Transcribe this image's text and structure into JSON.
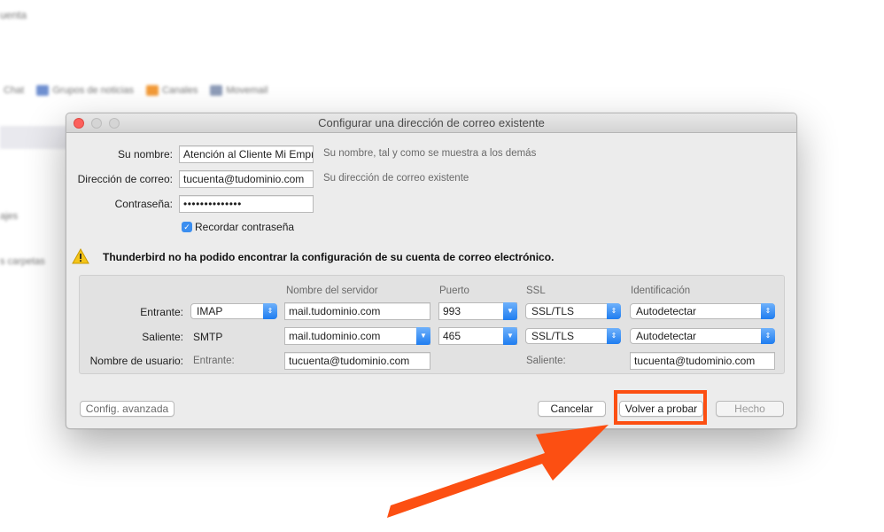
{
  "background": {
    "title_fragment": "uenta",
    "toolbar": [
      {
        "label": "Chat",
        "icon": "chat-icon",
        "color": "#8aa4d6"
      },
      {
        "label": "Grupos de noticias",
        "icon": "newsgroups-icon",
        "color": "#6f8fd0"
      },
      {
        "label": "Canales",
        "icon": "feeds-icon",
        "color": "#f29a38"
      },
      {
        "label": "Movemail",
        "icon": "movemail-icon",
        "color": "#8e9cb8"
      }
    ],
    "side_fragments": [
      "ajes",
      "s carpetas"
    ]
  },
  "dialog": {
    "title": "Configurar una dirección de correo existente",
    "name": {
      "label": "Su nombre:",
      "value": "Atención al Cliente Mi Empr",
      "hint": "Su nombre, tal y como se muestra a los demás"
    },
    "email": {
      "label": "Dirección de correo:",
      "value": "tucuenta@tudominio.com",
      "hint": "Su dirección de correo existente"
    },
    "password": {
      "label": "Contraseña:",
      "value": "••••••••••••••"
    },
    "remember": {
      "label": "Recordar contraseña",
      "checked": true
    },
    "warning": "Thunderbird no ha podido encontrar la configuración de su cuenta de correo electrónico.",
    "columns": {
      "server": "Nombre del servidor",
      "port": "Puerto",
      "ssl": "SSL",
      "auth": "Identificación"
    },
    "incoming": {
      "label": "Entrante:",
      "protocol": "IMAP",
      "server": "mail.tudominio.com",
      "port": "993",
      "ssl": "SSL/TLS",
      "auth": "Autodetectar"
    },
    "outgoing": {
      "label": "Saliente:",
      "protocol": "SMTP",
      "server": "mail.tudominio.com",
      "port": "465",
      "ssl": "SSL/TLS",
      "auth": "Autodetectar"
    },
    "username": {
      "label": "Nombre de usuario:",
      "in_label": "Entrante:",
      "in_value": "tucuenta@tudominio.com",
      "out_label": "Saliente:",
      "out_value": "tucuenta@tudominio.com"
    },
    "buttons": {
      "advanced": "Config. avanzada",
      "cancel": "Cancelar",
      "retest": "Volver a probar",
      "done": "Hecho"
    }
  },
  "annotation": {
    "color": "#fc4f12"
  }
}
